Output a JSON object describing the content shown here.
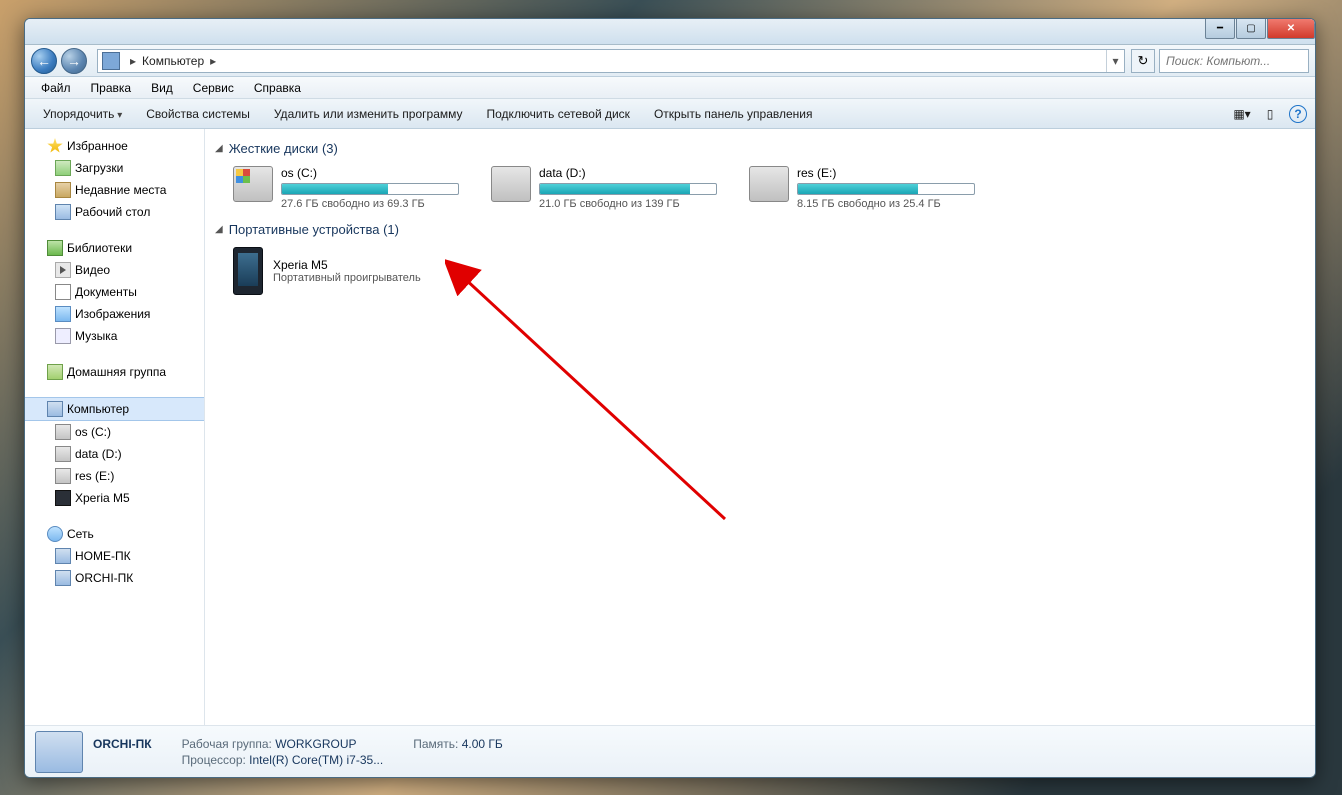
{
  "titlebar": {},
  "address": {
    "location": "Компьютер",
    "arrow": "▸"
  },
  "search": {
    "placeholder": "Поиск: Компьют..."
  },
  "menu": {
    "file": "Файл",
    "edit": "Правка",
    "view": "Вид",
    "tools": "Сервис",
    "help": "Справка"
  },
  "cmd": {
    "organize": "Упорядочить",
    "props": "Свойства системы",
    "uninstall": "Удалить или изменить программу",
    "mapdrive": "Подключить сетевой диск",
    "controlpanel": "Открыть панель управления"
  },
  "nav": {
    "favorites": "Избранное",
    "downloads": "Загрузки",
    "recent": "Недавние места",
    "desktop": "Рабочий стол",
    "libraries": "Библиотеки",
    "video": "Видео",
    "documents": "Документы",
    "pictures": "Изображения",
    "music": "Музыка",
    "homegroup": "Домашняя группа",
    "computer": "Компьютер",
    "drive_os": "os (C:)",
    "drive_data": "data (D:)",
    "drive_res": "res (E:)",
    "xperia": "Xperia M5",
    "network": "Сеть",
    "home_pc": "HOME-ПК",
    "orchi_pc": "ORCHI-ПК"
  },
  "groups": {
    "hdd": "Жесткие диски",
    "hdd_count": "(3)",
    "portable": "Портативные устройства",
    "portable_count": "(1)"
  },
  "drives": [
    {
      "name": "os (C:)",
      "free_text": "27.6 ГБ свободно из 69.3 ГБ",
      "fill_pct": 60
    },
    {
      "name": "data (D:)",
      "free_text": "21.0 ГБ свободно из 139 ГБ",
      "fill_pct": 85
    },
    {
      "name": "res (E:)",
      "free_text": "8.15 ГБ свободно из 25.4 ГБ",
      "fill_pct": 68
    }
  ],
  "device": {
    "name": "Xperia M5",
    "sub": "Портативный проигрыватель"
  },
  "details": {
    "name": "ORCHI-ПК",
    "workgroup_label": "Рабочая группа:",
    "workgroup": "WORKGROUP",
    "memory_label": "Память:",
    "memory": "4.00 ГБ",
    "cpu_label": "Процессор:",
    "cpu": "Intel(R) Core(TM) i7-35..."
  }
}
